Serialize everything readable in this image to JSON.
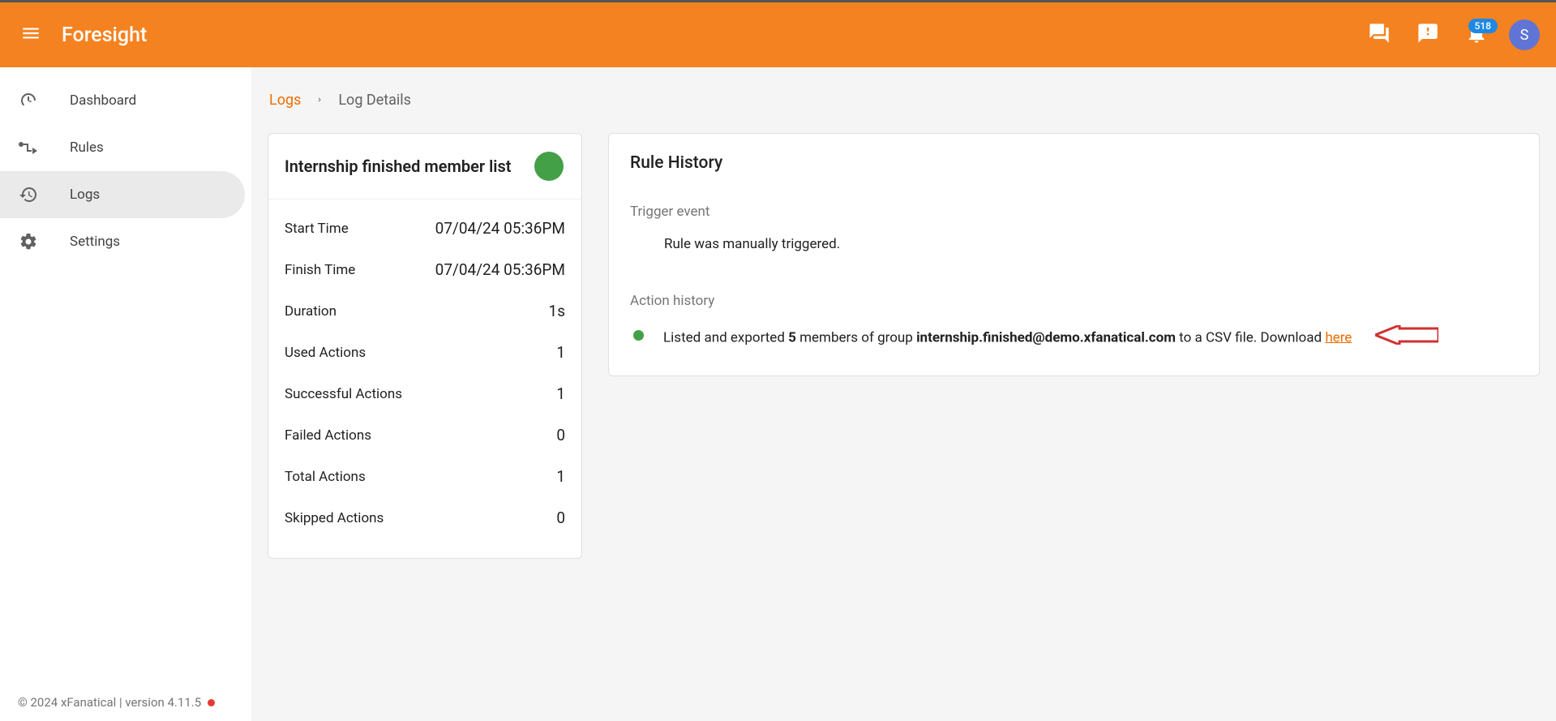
{
  "app": {
    "name": "Foresight",
    "notification_count": "518",
    "avatar_letter": "S"
  },
  "sidebar": {
    "items": [
      {
        "label": "Dashboard"
      },
      {
        "label": "Rules"
      },
      {
        "label": "Logs"
      },
      {
        "label": "Settings"
      }
    ],
    "footer": "© 2024 xFanatical | version 4.11.5"
  },
  "breadcrumb": {
    "root": "Logs",
    "current": "Log Details"
  },
  "summary": {
    "title": "Internship finished member list",
    "rows": {
      "start_label": "Start Time",
      "start_value": "07/04/24 05:36PM",
      "finish_label": "Finish Time",
      "finish_value": "07/04/24 05:36PM",
      "duration_label": "Duration",
      "duration_value": "1s",
      "used_label": "Used Actions",
      "used_value": "1",
      "successful_label": "Successful Actions",
      "successful_value": "1",
      "failed_label": "Failed Actions",
      "failed_value": "0",
      "total_label": "Total Actions",
      "total_value": "1",
      "skipped_label": "Skipped Actions",
      "skipped_value": "0"
    }
  },
  "history": {
    "title": "Rule History",
    "trigger_label": "Trigger event",
    "trigger_text": "Rule was manually triggered.",
    "action_label": "Action history",
    "action_prefix": "Listed and exported ",
    "action_count": "5",
    "action_mid": " members of group ",
    "action_group": "internship.finished@demo.xfanatical.com",
    "action_suffix": " to a CSV file. Download ",
    "action_link": "here"
  }
}
